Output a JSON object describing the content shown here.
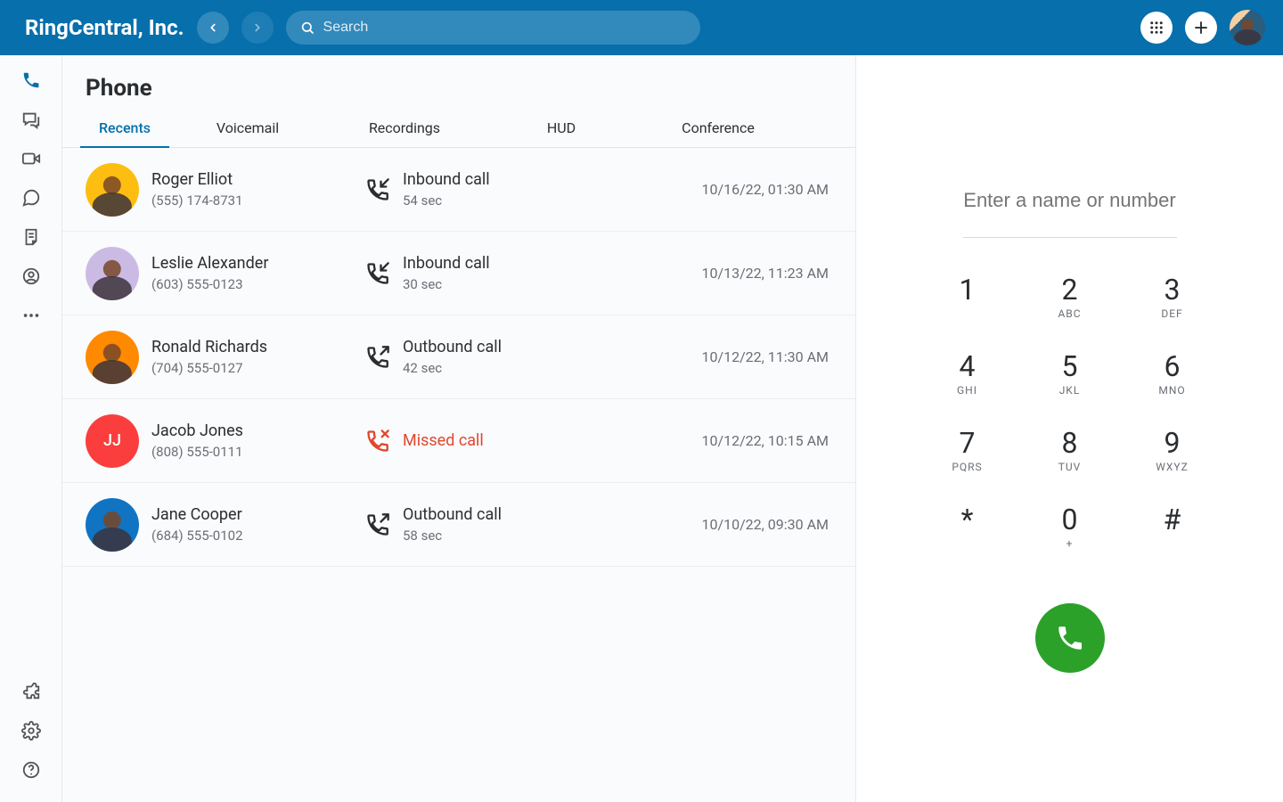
{
  "header": {
    "brand": "RingCentral, Inc.",
    "search_placeholder": "Search"
  },
  "page": {
    "title": "Phone"
  },
  "tabs": [
    {
      "key": "recents",
      "label": "Recents",
      "active": true
    },
    {
      "key": "voicemail",
      "label": "Voicemail",
      "active": false
    },
    {
      "key": "recordings",
      "label": "Recordings",
      "active": false
    },
    {
      "key": "hud",
      "label": "HUD",
      "active": false
    },
    {
      "key": "conference",
      "label": "Conference",
      "active": false
    }
  ],
  "dialer": {
    "placeholder": "Enter a name or number",
    "keys": [
      {
        "num": "1",
        "sub": ""
      },
      {
        "num": "2",
        "sub": "ABC"
      },
      {
        "num": "3",
        "sub": "DEF"
      },
      {
        "num": "4",
        "sub": "GHI"
      },
      {
        "num": "5",
        "sub": "JKL"
      },
      {
        "num": "6",
        "sub": "MNO"
      },
      {
        "num": "7",
        "sub": "PQRS"
      },
      {
        "num": "8",
        "sub": "TUV"
      },
      {
        "num": "9",
        "sub": "WXYZ"
      },
      {
        "num": "*",
        "sub": ""
      },
      {
        "num": "0",
        "sub": "+"
      },
      {
        "num": "#",
        "sub": ""
      }
    ]
  },
  "calls": [
    {
      "name": "Roger Elliot",
      "phone": "(555) 174-8731",
      "type": "inbound",
      "type_label": "Inbound call",
      "duration": "54 sec",
      "timestamp": "10/16/22, 01:30 AM",
      "avatar": {
        "kind": "photo",
        "bg": "bg-yellow"
      }
    },
    {
      "name": "Leslie Alexander",
      "phone": "(603) 555-0123",
      "type": "inbound",
      "type_label": "Inbound call",
      "duration": "30 sec",
      "timestamp": "10/13/22, 11:23 AM",
      "avatar": {
        "kind": "photo",
        "bg": "bg-lav"
      }
    },
    {
      "name": "Ronald Richards",
      "phone": "(704) 555-0127",
      "type": "outbound",
      "type_label": "Outbound call",
      "duration": "42 sec",
      "timestamp": "10/12/22, 11:30 AM",
      "avatar": {
        "kind": "photo",
        "bg": "bg-orange"
      }
    },
    {
      "name": "Jacob Jones",
      "phone": "(808) 555-0111",
      "type": "missed",
      "type_label": "Missed call",
      "duration": "",
      "timestamp": "10/12/22, 10:15 AM",
      "avatar": {
        "kind": "initials",
        "initials": "JJ",
        "bg": "bg-red"
      }
    },
    {
      "name": "Jane Cooper",
      "phone": "(684) 555-0102",
      "type": "outbound",
      "type_label": "Outbound call",
      "duration": "58 sec",
      "timestamp": "10/10/22, 09:30 AM",
      "avatar": {
        "kind": "photo",
        "bg": "bg-blue"
      }
    }
  ]
}
